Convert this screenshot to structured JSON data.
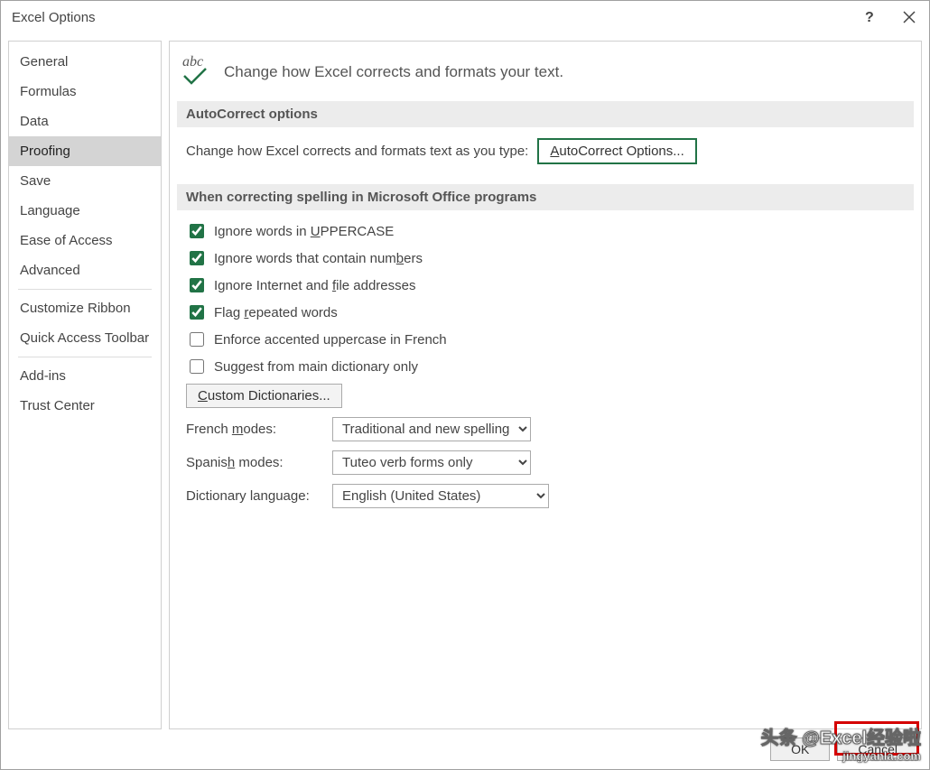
{
  "window": {
    "title": "Excel Options"
  },
  "sidebar": {
    "items": [
      {
        "label": "General"
      },
      {
        "label": "Formulas"
      },
      {
        "label": "Data"
      },
      {
        "label": "Proofing",
        "selected": true
      },
      {
        "label": "Save"
      },
      {
        "label": "Language"
      },
      {
        "label": "Ease of Access"
      },
      {
        "label": "Advanced"
      }
    ],
    "group2": [
      {
        "label": "Customize Ribbon"
      },
      {
        "label": "Quick Access Toolbar"
      }
    ],
    "group3": [
      {
        "label": "Add-ins"
      },
      {
        "label": "Trust Center"
      }
    ]
  },
  "hero": {
    "icon_text": "abc",
    "text": "Change how Excel corrects and formats your text."
  },
  "sections": {
    "autocorrect": {
      "title": "AutoCorrect options",
      "label": "Change how Excel corrects and formats text as you type:",
      "button_pre": "A",
      "button_rest": "utoCorrect Options..."
    },
    "spelling": {
      "title": "When correcting spelling in Microsoft Office programs",
      "checks": [
        {
          "checked": true,
          "pre": "Ignore words in ",
          "u": "U",
          "post": "PPERCASE"
        },
        {
          "checked": true,
          "pre": "Ignore words that contain num",
          "u": "b",
          "post": "ers"
        },
        {
          "checked": true,
          "pre": "Ignore Internet and ",
          "u": "f",
          "post": "ile addresses"
        },
        {
          "checked": true,
          "pre": "Flag ",
          "u": "r",
          "post": "epeated words"
        },
        {
          "checked": false,
          "pre": "Enforce accented uppercase in French",
          "u": "",
          "post": ""
        },
        {
          "checked": false,
          "pre": "Suggest from main dictionary only",
          "u": "",
          "post": ""
        }
      ],
      "custom_dict_pre": "C",
      "custom_dict_rest": "ustom Dictionaries...",
      "french_label_pre": "French ",
      "french_label_u": "m",
      "french_label_post": "odes:",
      "french_value": "Traditional and new spellings",
      "spanish_label_pre": "Spanis",
      "spanish_label_u": "h",
      "spanish_label_post": " modes:",
      "spanish_value": "Tuteo verb forms only",
      "dict_label": "Dictionary language:",
      "dict_value": "English (United States)"
    }
  },
  "footer": {
    "ok": "OK",
    "cancel": "Cancel"
  },
  "watermark": {
    "line1": "头条 @Excel经验啦",
    "line2": "jingyanla.com"
  }
}
